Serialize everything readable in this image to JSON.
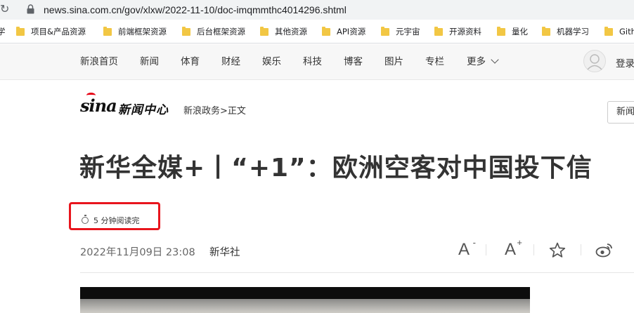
{
  "browser": {
    "url": "news.sina.com.cn/gov/xlxw/2022-11-10/doc-imqmmthc4014296.shtml"
  },
  "bookmarks": [
    {
      "label": "学"
    },
    {
      "label": "项目&产品资源"
    },
    {
      "label": "前端框架资源"
    },
    {
      "label": "后台框架资源"
    },
    {
      "label": "其他资源"
    },
    {
      "label": "API资源"
    },
    {
      "label": "元宇宙"
    },
    {
      "label": "开源资料"
    },
    {
      "label": "量化"
    },
    {
      "label": "机器学习"
    },
    {
      "label": "Gith"
    }
  ],
  "nav": {
    "items": [
      {
        "label": "新浪首页"
      },
      {
        "label": "新闻"
      },
      {
        "label": "体育"
      },
      {
        "label": "财经"
      },
      {
        "label": "娱乐"
      },
      {
        "label": "科技"
      },
      {
        "label": "博客"
      },
      {
        "label": "图片"
      },
      {
        "label": "专栏"
      },
      {
        "label": "更多"
      }
    ],
    "login": "登录"
  },
  "header": {
    "logo_text": "sina",
    "logo_title": "新闻中心",
    "breadcrumb": "新浪政务>正文",
    "side_button": "新闻"
  },
  "article": {
    "headline": "新华全媒+丨“+1”：欧洲空客对中国投下信",
    "read_time": "5 分钟阅读完",
    "date": "2022年11月09日 23:08",
    "source": "新华社"
  },
  "tools": {
    "font_letter": "A",
    "decrease_mark": "-",
    "increase_mark": "+"
  },
  "colors": {
    "highlight": "#e8151d",
    "logo_red": "#e60012"
  }
}
